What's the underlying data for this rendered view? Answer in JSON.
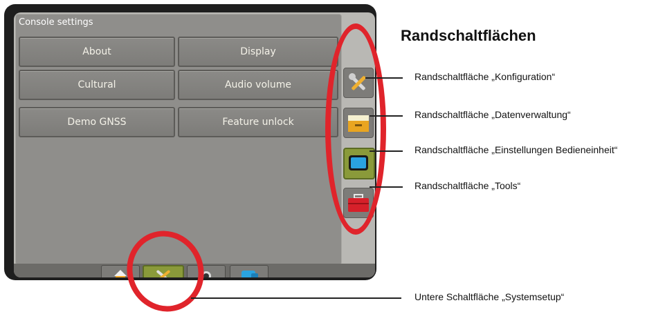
{
  "panel": {
    "title": "Console settings"
  },
  "buttons": {
    "about": "About",
    "display": "Display",
    "cultural": "Cultural",
    "audio_volume": "Audio volume",
    "demo_gnss": "Demo GNSS",
    "feature_unlock": "Feature unlock"
  },
  "side_buttons": [
    {
      "icon": "wrench-screwdriver-icon"
    },
    {
      "icon": "file-drawer-icon"
    },
    {
      "icon": "console-screen-icon",
      "active": true
    },
    {
      "icon": "toolbox-icon"
    }
  ],
  "bottom_tabs": [
    {
      "icon": "home-icon"
    },
    {
      "icon": "wrench-screwdriver-icon",
      "active": true
    },
    {
      "icon": "camera-lens-icon"
    },
    {
      "icon": "guidance-icon"
    }
  ],
  "annotations": {
    "heading": "Randschaltflächen",
    "configuration": "Randschaltfläche „Konfiguration“",
    "data_management": "Randschaltfläche „Datenverwaltung“",
    "console_settings": "Randschaltfläche „Einstellungen Bedieneinheit“",
    "tools": "Randschaltfläche „Tools“",
    "system_setup": "Untere Schaltfläche „Systemsetup“"
  },
  "colors": {
    "highlight_ring": "#e0242b",
    "active_green": "#8a9a3a",
    "panel_gray": "#8f8e8b"
  }
}
